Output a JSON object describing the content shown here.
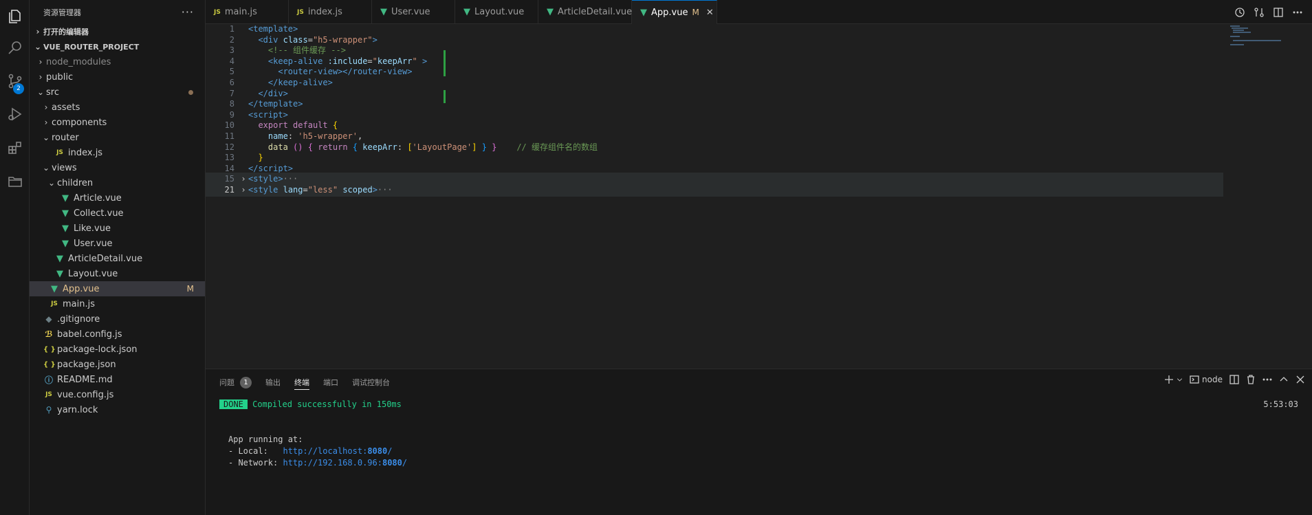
{
  "activity_bar": {
    "items": [
      {
        "name": "explorer",
        "icon": "files-icon"
      },
      {
        "name": "search",
        "icon": "search-icon"
      },
      {
        "name": "source-control",
        "icon": "source-control-icon",
        "badge": "2"
      },
      {
        "name": "run-debug",
        "icon": "debug-icon"
      },
      {
        "name": "extensions",
        "icon": "extensions-icon"
      },
      {
        "name": "remote-explorer",
        "icon": "folder-icon"
      }
    ]
  },
  "sidebar": {
    "title": "资源管理器",
    "more": "···",
    "open_editors": "打开的编辑器",
    "project": "VUE_ROUTER_PROJECT",
    "tree": [
      {
        "label": "node_modules",
        "type": "folder",
        "collapsed": true,
        "depth": 0,
        "muted": true
      },
      {
        "label": "public",
        "type": "folder",
        "collapsed": true,
        "depth": 0
      },
      {
        "label": "src",
        "type": "folder",
        "collapsed": false,
        "depth": 0,
        "dot": true
      },
      {
        "label": "assets",
        "type": "folder",
        "collapsed": true,
        "depth": 1
      },
      {
        "label": "components",
        "type": "folder",
        "collapsed": true,
        "depth": 1
      },
      {
        "label": "router",
        "type": "folder",
        "collapsed": false,
        "depth": 1
      },
      {
        "label": "index.js",
        "type": "js",
        "depth": 2
      },
      {
        "label": "views",
        "type": "folder",
        "collapsed": false,
        "depth": 1
      },
      {
        "label": "children",
        "type": "folder",
        "collapsed": false,
        "depth": 2
      },
      {
        "label": "Article.vue",
        "type": "vue",
        "depth": 3
      },
      {
        "label": "Collect.vue",
        "type": "vue",
        "depth": 3
      },
      {
        "label": "Like.vue",
        "type": "vue",
        "depth": 3
      },
      {
        "label": "User.vue",
        "type": "vue",
        "depth": 3
      },
      {
        "label": "ArticleDetail.vue",
        "type": "vue",
        "depth": 2
      },
      {
        "label": "Layout.vue",
        "type": "vue",
        "depth": 2
      },
      {
        "label": "App.vue",
        "type": "vue",
        "depth": 1,
        "selected": true,
        "badge": "M"
      },
      {
        "label": "main.js",
        "type": "js",
        "depth": 1
      },
      {
        "label": ".gitignore",
        "type": "git",
        "depth": 0
      },
      {
        "label": "babel.config.js",
        "type": "babel",
        "depth": 0
      },
      {
        "label": "package-lock.json",
        "type": "json",
        "depth": 0
      },
      {
        "label": "package.json",
        "type": "json",
        "depth": 0
      },
      {
        "label": "README.md",
        "type": "info",
        "depth": 0
      },
      {
        "label": "vue.config.js",
        "type": "js",
        "depth": 0
      },
      {
        "label": "yarn.lock",
        "type": "yarn",
        "depth": 0
      }
    ]
  },
  "tabs": [
    {
      "label": "main.js",
      "type": "js"
    },
    {
      "label": "index.js",
      "type": "js"
    },
    {
      "label": "User.vue",
      "type": "vue"
    },
    {
      "label": "Layout.vue",
      "type": "vue"
    },
    {
      "label": "ArticleDetail.vue",
      "type": "vue"
    },
    {
      "label": "App.vue",
      "type": "vue",
      "active": true,
      "modified": "M",
      "close": "✕"
    }
  ],
  "tab_actions": [
    "history-icon",
    "compare-changes-icon",
    "split-editor-icon",
    "more-icon"
  ],
  "code": [
    {
      "n": "1",
      "html": "<span class='tag'>&lt;template&gt;</span>"
    },
    {
      "n": "2",
      "html": "  <span class='tag'>&lt;div</span> <span class='attr'>class</span><span class='plain'>=</span><span class='str'>\"h5-wrapper\"</span><span class='tag'>&gt;</span>"
    },
    {
      "n": "3",
      "html": "    <span class='cmt'>&lt;!-- 组件缓存 --&gt;</span>"
    },
    {
      "n": "4",
      "html": "    <span class='tag'>&lt;keep-alive</span> <span class='attr'>:include</span><span class='plain'>=</span><span class='str'>\"</span><span class='prop'>keepArr</span><span class='str'>\"</span> <span class='tag'>&gt;</span>"
    },
    {
      "n": "5",
      "html": "      <span class='tag'>&lt;router-view&gt;&lt;/router-view&gt;</span>"
    },
    {
      "n": "6",
      "html": "    <span class='tag'>&lt;/keep-alive&gt;</span>"
    },
    {
      "n": "7",
      "html": "  <span class='tag'>&lt;/div&gt;</span>"
    },
    {
      "n": "8",
      "html": "<span class='tag'>&lt;/template&gt;</span>"
    },
    {
      "n": "9",
      "html": "<span class='tag'>&lt;script&gt;</span>"
    },
    {
      "n": "10",
      "html": "  <span class='kw'>export</span> <span class='kw'>default</span> <span class='br1'>{</span>"
    },
    {
      "n": "11",
      "html": "    <span class='prop'>name</span><span class='plain'>:</span> <span class='str'>'h5-wrapper'</span><span class='plain'>,</span>"
    },
    {
      "n": "12",
      "html": "    <span class='fn'>data</span> <span class='br2'>()</span> <span class='br2'>{</span> <span class='kw'>return</span> <span class='br3'>{</span> <span class='prop'>keepArr</span><span class='plain'>:</span> <span class='br1'>[</span><span class='str'>'LayoutPage'</span><span class='br1'>]</span> <span class='br3'>}</span> <span class='br2'>}</span>    <span class='cmt'>// 缓存组件名的数组</span>"
    },
    {
      "n": "13",
      "html": "  <span class='br1'>}</span>"
    },
    {
      "n": "14",
      "html": "<span class='tag'>&lt;/script&gt;</span>"
    },
    {
      "n": "15",
      "html": "<span class='tag'>&lt;style&gt;</span><span class='ell'>···</span>",
      "folded": true
    },
    {
      "n": "21",
      "html": "<span class='tag'>&lt;style</span> <span class='attr'>lang</span><span class='plain'>=</span><span class='str'>\"less\"</span> <span class='attr'>scoped</span><span class='tag'>&gt;</span><span class='ell'>···</span>",
      "folded": true,
      "current": true
    }
  ],
  "panel": {
    "tabs": [
      {
        "label": "问题",
        "badge": "1"
      },
      {
        "label": "输出"
      },
      {
        "label": "终端",
        "active": true
      },
      {
        "label": "端口"
      },
      {
        "label": "调试控制台"
      }
    ],
    "terminal_name": "node",
    "actions": [
      "add-icon",
      "chevron-down-icon",
      "terminal-icon",
      "split-icon",
      "trash-icon",
      "more-icon",
      "maximize-icon",
      "close-icon"
    ],
    "terminal": {
      "done": "DONE",
      "compiled": "Compiled successfully in 150ms",
      "time": "5:53:03",
      "app_running": "App running at:",
      "local_label": "- Local:   ",
      "local_url_host": "http://localhost:",
      "local_url_port": "8080",
      "local_url_tail": "/",
      "network_label": "- Network: ",
      "network_url_host": "http://192.168.0.96:",
      "network_url_port": "8080",
      "network_url_tail": "/"
    }
  }
}
